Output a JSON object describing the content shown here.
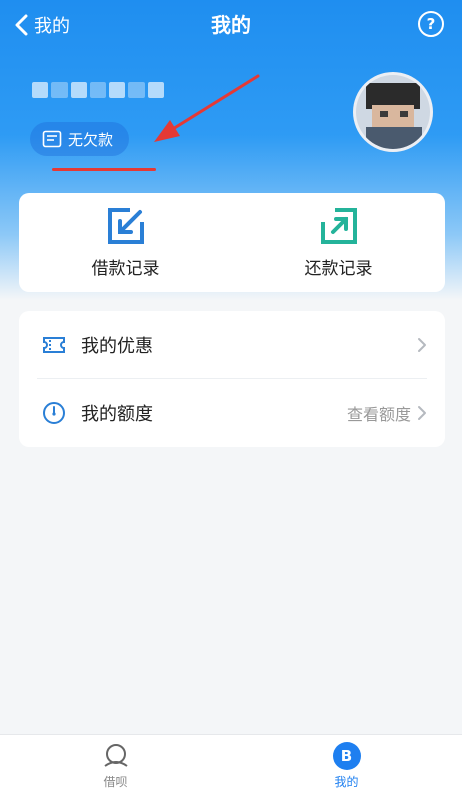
{
  "nav": {
    "back_label": "我的",
    "title": "我的"
  },
  "profile": {
    "status_badge": "无欠款"
  },
  "quick_actions": [
    {
      "label": "借款记录",
      "icon": "borrow-record-icon",
      "color": "#2a7fd6"
    },
    {
      "label": "还款记录",
      "icon": "repay-record-icon",
      "color": "#24b39a"
    }
  ],
  "menu": [
    {
      "label": "我的优惠",
      "extra": "",
      "icon": "ticket-icon"
    },
    {
      "label": "我的额度",
      "extra": "查看额度",
      "icon": "gauge-icon"
    }
  ],
  "tabs": [
    {
      "label": "借呗",
      "icon": "jiebei-icon",
      "active": false
    },
    {
      "label": "我的",
      "icon": "profile-icon",
      "active": true,
      "icon_text": "B"
    }
  ],
  "colors": {
    "accent": "#1e7ff0",
    "hero": "#1f8ef0",
    "annotation": "#e53935"
  }
}
